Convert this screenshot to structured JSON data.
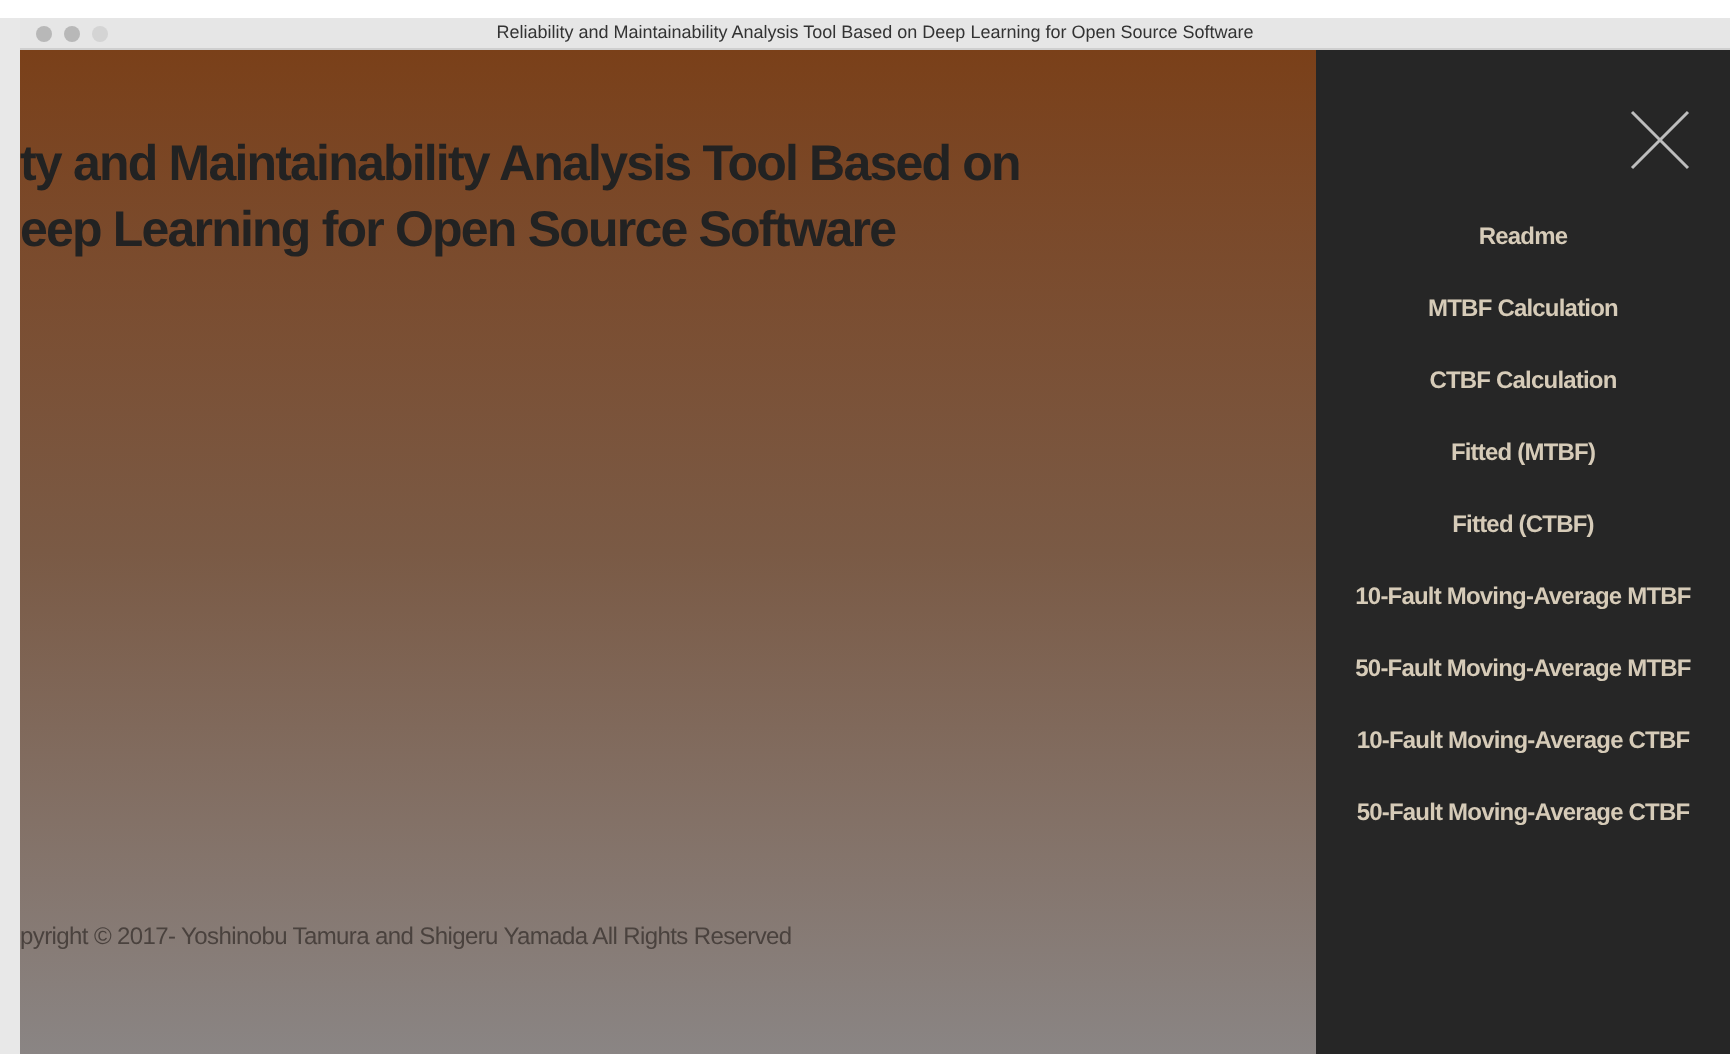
{
  "window": {
    "title": "Reliability and Maintainability Analysis Tool Based on Deep Learning for Open Source Software"
  },
  "heading": {
    "lines": [
      "ty and Maintainability Analysis Tool Based on",
      "eep Learning for Open Source Software"
    ]
  },
  "footer": {
    "copyright": "pyright ©   2017- Yoshinobu Tamura and Shigeru Yamada All Rights Reserved"
  },
  "menu": {
    "items": [
      {
        "label": "Readme"
      },
      {
        "label": "MTBF Calculation"
      },
      {
        "label": "CTBF Calculation"
      },
      {
        "label": "Fitted (MTBF)"
      },
      {
        "label": "Fitted (CTBF)"
      },
      {
        "label": "10-Fault Moving-Average MTBF"
      },
      {
        "label": "50-Fault Moving-Average MTBF"
      },
      {
        "label": "10-Fault Moving-Average CTBF"
      },
      {
        "label": "50-Fault Moving-Average CTBF"
      }
    ]
  }
}
